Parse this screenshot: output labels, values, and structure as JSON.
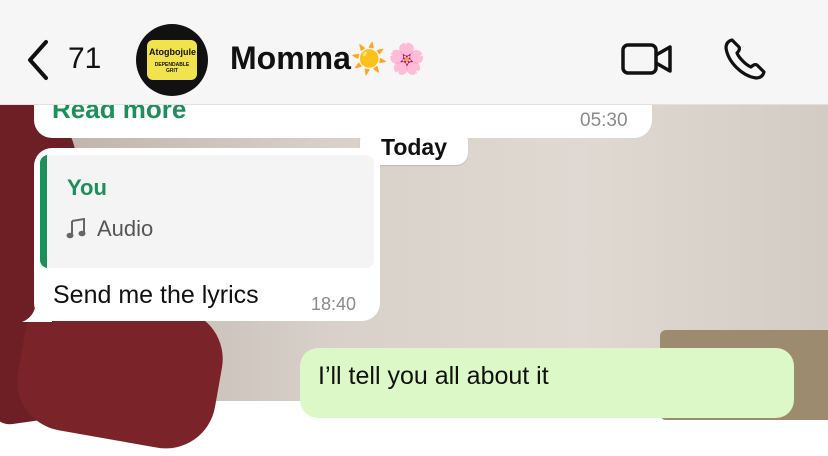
{
  "header": {
    "unread_count": "71",
    "contact_name": "Momma",
    "contact_emoji": "☀️🌸",
    "avatar_text_main": "Atogbojule",
    "avatar_text_sub": "DEPENDABLE GRIT",
    "icons": [
      "chevron-left-icon",
      "video-camera-icon",
      "phone-icon"
    ]
  },
  "previous_message": {
    "link_text": "Read more",
    "time": "05:30"
  },
  "date_separator": "Today",
  "incoming_message": {
    "quoted_author": "You",
    "quoted_icon": "music-note-icon",
    "quoted_text": "Audio",
    "text": "Send me the lyrics",
    "time": "18:40"
  },
  "outgoing_message": {
    "text": "I’ll tell you all about it"
  },
  "colors": {
    "accent_green": "#1c8f5b",
    "outgoing_bubble": "#dcf8c6",
    "incoming_bubble": "#ffffff",
    "header_bg": "#f6f6f6"
  }
}
